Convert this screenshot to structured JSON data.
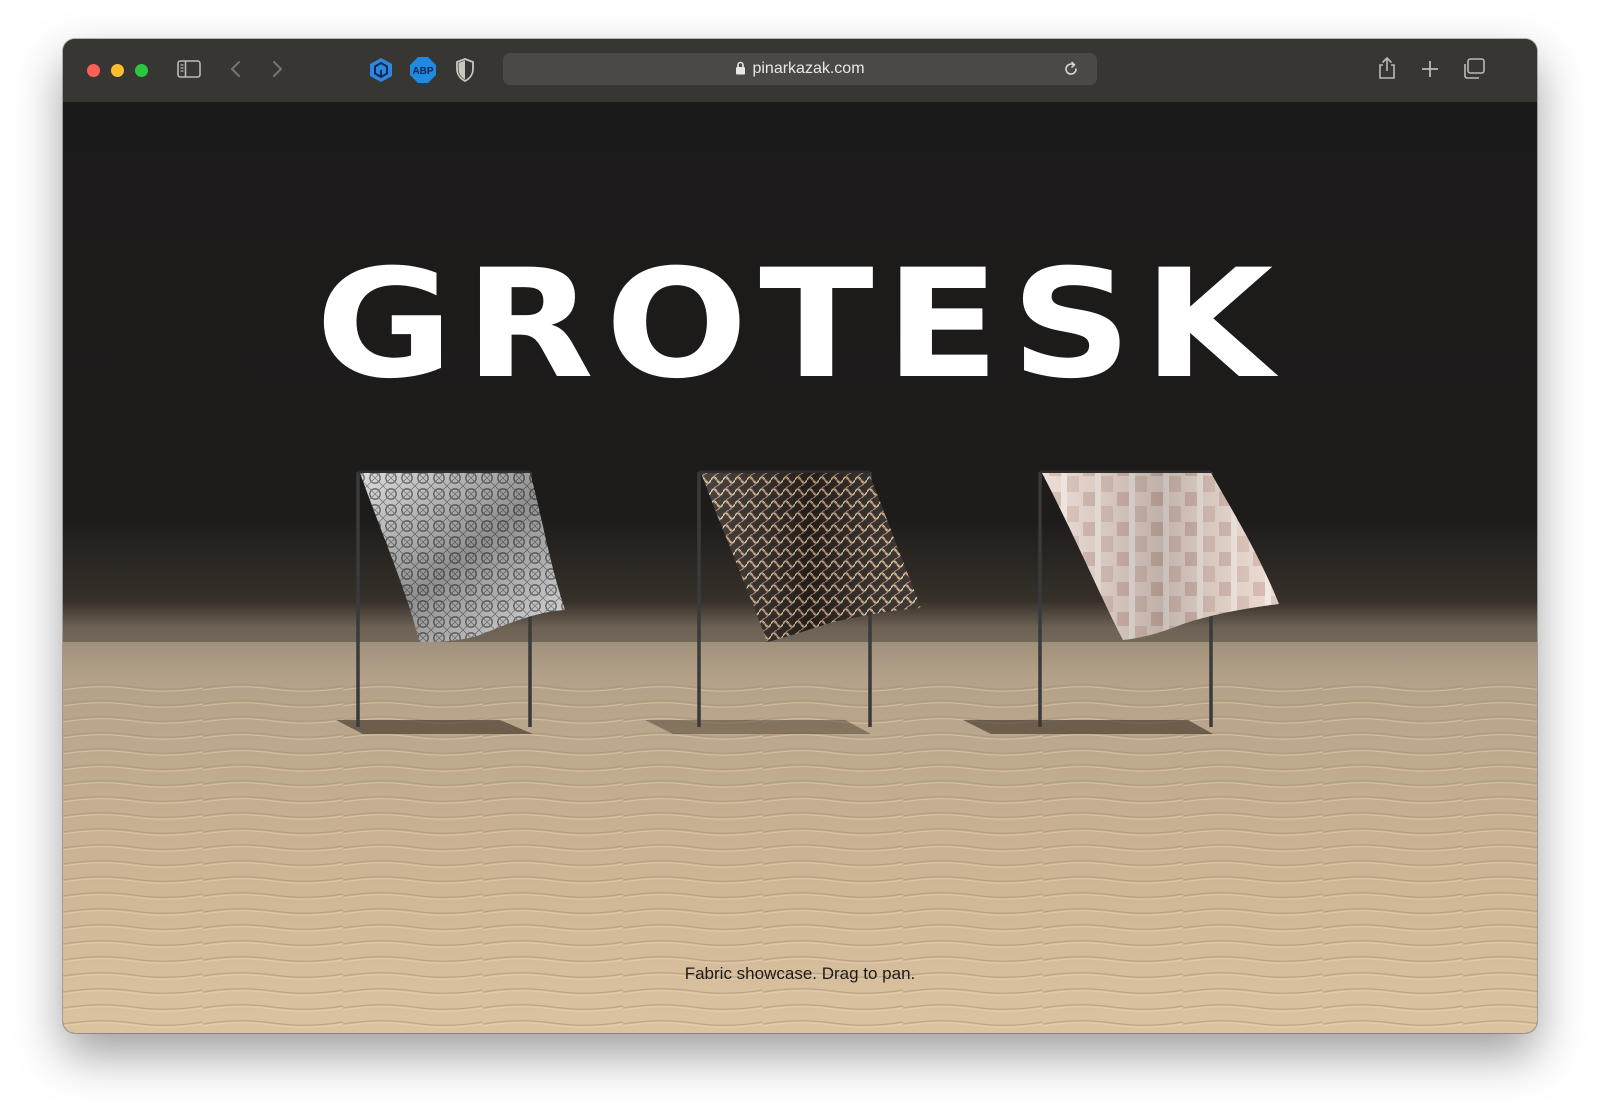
{
  "browser": {
    "url": "pinarkazak.com",
    "extensions": [
      "cube-extension-icon",
      "ABP",
      "shield-icon"
    ]
  },
  "page": {
    "title": "GROTESK",
    "caption": "Fabric showcase. Drag to pan.",
    "fabrics": [
      {
        "name": "grey-geometric-fabric",
        "pattern": "grey-geometric"
      },
      {
        "name": "gold-lattice-fabric",
        "pattern": "gold-lattice"
      },
      {
        "name": "pink-block-fabric",
        "pattern": "pink-block"
      }
    ]
  },
  "colors": {
    "toolbar": "#383632",
    "url_bar": "#4b4945",
    "sky": "#1b1a1a",
    "sand": "#d4bd9a",
    "title": "#ffffff",
    "caption": "#1d1b18"
  }
}
